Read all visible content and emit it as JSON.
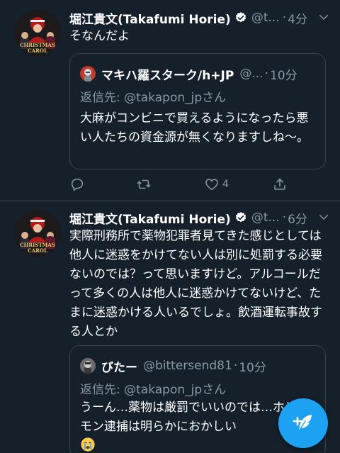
{
  "tweets": [
    {
      "author_name": "堀江貴文(Takafumi Horie)",
      "handle": "@t...",
      "dot": "·",
      "time": "4分",
      "text": "そなんだよ",
      "quote": {
        "name": "マキハ羅スターク/h+JP",
        "handle": "@...",
        "dot": "·",
        "time": "10分",
        "reply_to": "返信先: @takapon_jpさん",
        "text": "大麻がコンビニで買えるようになったら悪い人たちの資金源が無くなりますしね〜。"
      },
      "like_count": "4"
    },
    {
      "author_name": "堀江貴文(Takafumi Horie)",
      "handle": "@t...",
      "dot": "·",
      "time": "6分",
      "text": "実際刑務所で薬物犯罪者見てきた感じとしては他人に迷惑をかけてない人は別に処罰する必要ないのでは？って思いますけど。アルコールだって多くの人は他人に迷惑かけてないけど、たまに迷惑かける人いるでしょ。飲酒運転事故する人とか",
      "quote": {
        "name": "びたー",
        "handle": "@bittersend81",
        "dot": "·",
        "time": "10分",
        "reply_to": "返信先: @takapon_jpさん",
        "text": "うーん…薬物は厳罰でいいのでは…ホリエモン逮捕は明らかにおかしい"
      }
    }
  ],
  "avatar_text": {
    "line1": "CHRISTMAS",
    "line2": "CAROL"
  },
  "icons": {
    "verified": "verified-badge-icon",
    "caret": "chevron-down-icon",
    "reply": "reply-icon",
    "retweet": "retweet-icon",
    "like": "heart-icon",
    "share": "share-icon",
    "compose": "compose-feather-icon",
    "emoji": "crying-face-emoji"
  },
  "colors": {
    "background": "#15202b",
    "border": "#38444d",
    "secondary_text": "#8899a6",
    "accent": "#1da1f2"
  }
}
